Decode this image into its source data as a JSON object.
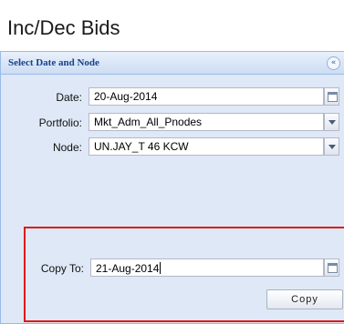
{
  "page": {
    "title": "Inc/Dec Bids"
  },
  "panel": {
    "title": "Select Date and Node",
    "collapse_glyph": "«"
  },
  "form": {
    "date": {
      "label": "Date:",
      "value": "20-Aug-2014",
      "trigger_icon": "calendar-icon"
    },
    "portfolio": {
      "label": "Portfolio:",
      "value": "Mkt_Adm_All_Pnodes",
      "trigger_icon": "chevron-down-icon"
    },
    "node": {
      "label": "Node:",
      "value": "UN.JAY_T 46 KCW",
      "trigger_icon": "chevron-down-icon"
    },
    "copy_to": {
      "label": "Copy To:",
      "value": "21-Aug-2014",
      "trigger_icon": "calendar-icon"
    }
  },
  "buttons": {
    "copy": "Copy"
  },
  "colors": {
    "panel_bg": "#dfe8f6",
    "panel_title": "#15428b",
    "highlight_border": "#e01818"
  }
}
